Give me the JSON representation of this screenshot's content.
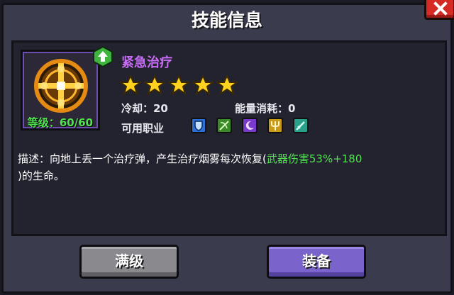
{
  "dialog": {
    "title": "技能信息"
  },
  "skill": {
    "name": "紧急治疗",
    "level_label": "等级：60/60",
    "stars": 5,
    "cooldown_label": "冷却：20",
    "energy_label": "能量消耗：0",
    "professions_label": "可用职业",
    "professions": [
      "shield-class-icon",
      "bow-class-icon",
      "moon-class-icon",
      "trident-class-icon",
      "dagger-class-icon"
    ]
  },
  "description": {
    "text_before": "描述：向地上丢一个治疗弹，产生治疗烟雾每次恢复(",
    "highlight": "武器伤害53%+180",
    "text_after": ")的生命。"
  },
  "buttons": {
    "max_level": "满级",
    "equip": "装备"
  },
  "colors": {
    "skill_name": "#c86cf6",
    "level": "#4fe44f",
    "highlight": "#54e054",
    "equip_button": "#7a64cc",
    "max_button": "#8a8a8e",
    "close": "#d62a24"
  }
}
